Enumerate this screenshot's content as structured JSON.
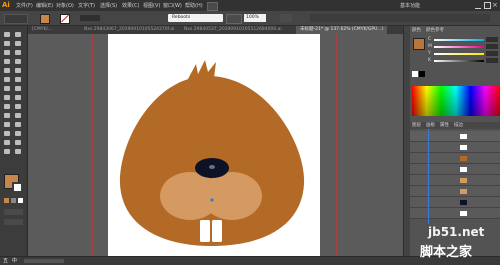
{
  "app": {
    "logo": "Ai"
  },
  "menu": [
    "文件(F)",
    "编辑(E)",
    "对象(O)",
    "文字(T)",
    "选择(S)",
    "效果(C)",
    "视图(V)",
    "窗口(W)",
    "帮助(H)"
  ],
  "workspace_label": "基本功能",
  "control_bar": {
    "font_name": "Reboots",
    "opacity_value": "100%"
  },
  "tabs": [
    "[CMYK/...",
    "Nxs 29843067_20190910105524370f.ai",
    "Nxs 29840537_20190910105512684000.ai",
    "未标题-21* @ 137.62% (CMYK/GPU...)"
  ],
  "panels": {
    "color_tabs": [
      "颜色",
      "颜色参考"
    ],
    "color_channels": [
      "C",
      "M",
      "Y",
      "K"
    ],
    "layer_tabs": [
      "图层",
      "画板",
      "属性",
      "描边"
    ],
    "swatch_color": "#b5773a"
  },
  "colors": {
    "fill": "#c8874a",
    "head": "#b36a26",
    "muzzle": "#e1a06a",
    "ear": "#d49a62",
    "nose": "#0d1226",
    "teeth": "#ffffff"
  },
  "taskbar": {
    "ime": "五",
    "ime2": "中"
  },
  "watermark": {
    "line1": "jb51.net",
    "line2": "脚本之家"
  }
}
